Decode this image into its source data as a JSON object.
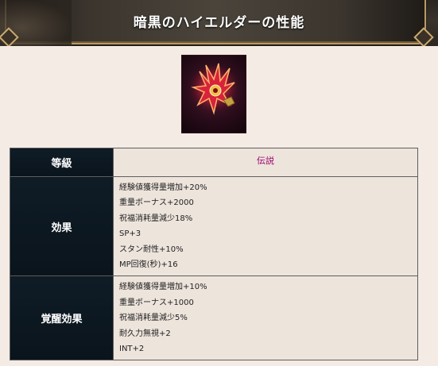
{
  "header": {
    "title": "暗黒のハイエルダーの性能"
  },
  "item": {
    "image_alt": "暗黒のハイエルダー アイコン"
  },
  "table": {
    "rows": [
      {
        "label": "等級",
        "values": [
          "伝説"
        ]
      },
      {
        "label": "効果",
        "values": [
          "経験値獲得量増加+20%",
          "重量ボーナス+2000",
          "祝福消耗量減少18%",
          "SP+3",
          "スタン耐性+10%",
          "MP回復(秒)+16"
        ]
      },
      {
        "label": "覚醒効果",
        "values": [
          "経験値獲得量増加+10%",
          "重量ボーナス+1000",
          "祝福消耗量減少5%",
          "耐久力無視+2",
          "INT+2"
        ]
      }
    ]
  },
  "colors": {
    "label_bg": "#0a141c",
    "rarity_text": "#9a006c",
    "value_bg": "#ede4dc",
    "page_bg": "#f3ebe4"
  }
}
